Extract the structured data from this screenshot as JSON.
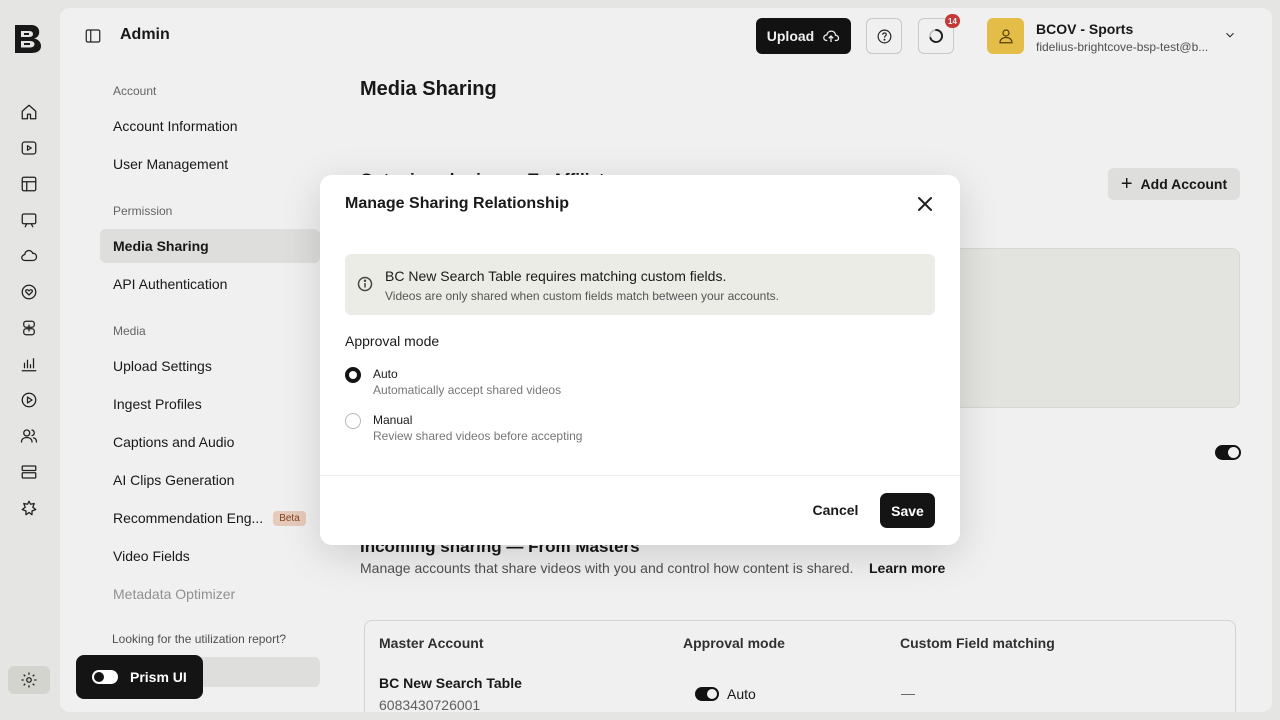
{
  "header": {
    "title": "Admin",
    "upload_label": "Upload",
    "notification_count": "14",
    "account_name": "BCOV - Sports",
    "account_email": "fidelius-brightcove-bsp-test@b..."
  },
  "nav": {
    "groups": {
      "account": "Account",
      "permission": "Permission",
      "media": "Media"
    },
    "items": {
      "account_information": "Account Information",
      "user_management": "User Management",
      "media_sharing": "Media Sharing",
      "api_authentication": "API Authentication",
      "upload_settings": "Upload Settings",
      "ingest_profiles": "Ingest Profiles",
      "captions_and_audio": "Captions and Audio",
      "ai_clips_generation": "AI Clips Generation",
      "recommendation_engine": "Recommendation Eng...",
      "recommendation_badge": "Beta",
      "video_fields": "Video Fields",
      "metadata_optimizer": "Metadata Optimizer"
    },
    "footer_text": "Looking for the utilization report?"
  },
  "page": {
    "title": "Media Sharing",
    "outgoing_title": "Outgoing sharing — To Affiliates",
    "add_account_label": "Add Account",
    "incoming_title": "Incoming sharing — From Masters",
    "incoming_desc": "Manage accounts that share videos with you and control how content is shared.",
    "learn_more": "Learn more",
    "table": {
      "headers": {
        "master_account": "Master Account",
        "approval_mode": "Approval mode",
        "custom_field_matching": "Custom Field matching"
      },
      "rows": [
        {
          "name": "BC New Search Table",
          "id": "6083430726001",
          "mode": "Auto",
          "matching": "—"
        }
      ]
    }
  },
  "prism": {
    "label": "Prism UI"
  },
  "modal": {
    "title": "Manage Sharing Relationship",
    "notice_title": "BC New Search Table requires matching custom fields.",
    "notice_desc": "Videos are only shared when custom fields match between your accounts.",
    "approval_label": "Approval mode",
    "options": [
      {
        "title": "Auto",
        "desc": "Automatically accept shared videos",
        "checked": true
      },
      {
        "title": "Manual",
        "desc": "Review shared videos before accepting",
        "checked": false
      }
    ],
    "cancel_label": "Cancel",
    "save_label": "Save"
  }
}
